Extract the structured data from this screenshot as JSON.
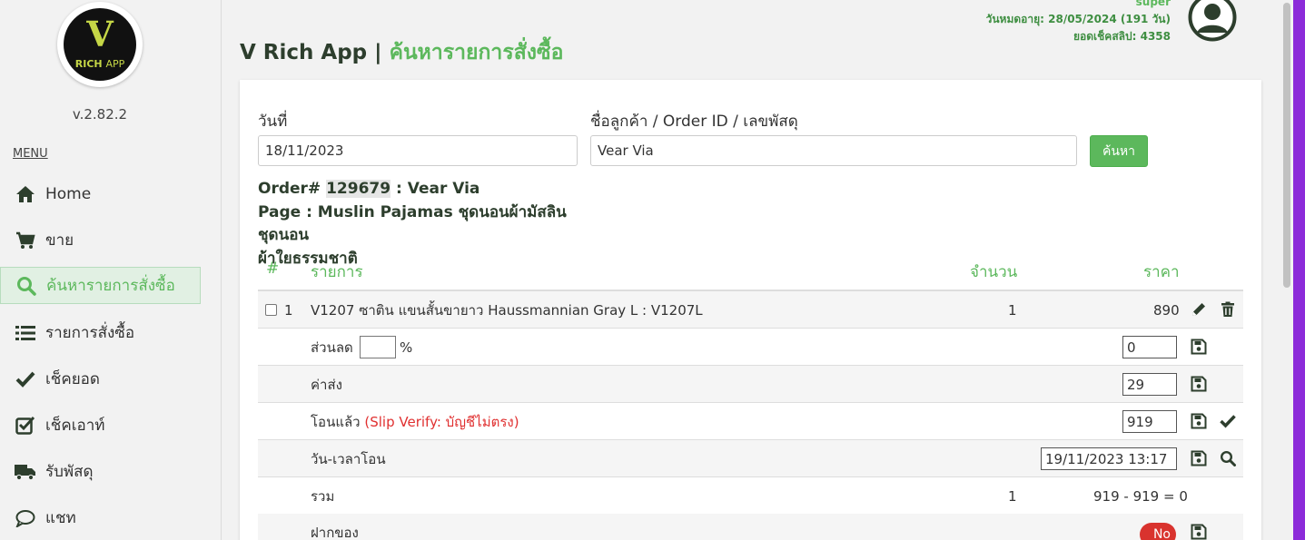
{
  "sidebar": {
    "logo_letter": "V",
    "logo_brand": "RICH",
    "logo_app": "APP",
    "version": "v.2.82.2",
    "menu_title": "MENU",
    "items": [
      {
        "label": "Home",
        "icon": "home-icon"
      },
      {
        "label": "ขาย",
        "icon": "cart-icon"
      },
      {
        "label": "ค้นหารายการสั่งซื้อ",
        "icon": "search-icon",
        "active": true
      },
      {
        "label": "รายการสั่งซื้อ",
        "icon": "list-icon"
      },
      {
        "label": "เช็คยอด",
        "icon": "check-icon"
      },
      {
        "label": "เช็คเอาท์",
        "icon": "check-square-icon"
      },
      {
        "label": "รับพัสดุ",
        "icon": "truck-icon"
      },
      {
        "label": "แชท",
        "icon": "chat-icon"
      }
    ]
  },
  "header": {
    "title_app": "V Rich App |",
    "title_page": "ค้นหารายการสั่งซื้อ",
    "user_name": "super",
    "expiry": "วันหมดอายุ: 28/05/2024 (191 วัน)",
    "slip_balance": "ยอดเช็คสลิป: 4358"
  },
  "search": {
    "date_label": "วันที่",
    "date_value": "18/11/2023",
    "query_label": "ชื่อลูกค้า / Order ID / เลขพัสดุ",
    "query_value": "Vear Via",
    "button_label": "ค้นหา"
  },
  "order": {
    "prefix": "Order#",
    "id": "129679",
    "customer": ": Vear Via",
    "page_line1": "Page : Muslin Pajamas ชุดนอนผ้ามัสลิน ชุดนอน",
    "page_line2": "ผ้าใยธรรมชาติ"
  },
  "table": {
    "headers": {
      "num": "#",
      "item": "รายการ",
      "qty": "จำนวน",
      "price": "ราคา"
    },
    "item_row": {
      "num": "1",
      "name": "V1207 ซาติน แขนสั้นขายาว Haussmannian Gray L : V1207L",
      "qty": "1",
      "price": "890"
    },
    "discount": {
      "label": "ส่วนลด",
      "percent_value": "",
      "percent_sign": "%",
      "value": "0"
    },
    "shipping": {
      "label": "ค่าส่ง",
      "value": "29"
    },
    "transferred": {
      "label": "โอนแล้ว",
      "note": "(Slip Verify: บัญชีไม่ตรง)",
      "value": "919"
    },
    "transfer_time": {
      "label": "วัน-เวลาโอน",
      "value": "19/11/2023 13:17"
    },
    "total": {
      "label": "รวม",
      "qty": "1",
      "calc": "919 - 919 = 0"
    },
    "deposit": {
      "label": "ฝากของ",
      "toggle": "No"
    }
  },
  "colors": {
    "accent": "#5cb85c",
    "dark_title": "#2d3e2d",
    "alert": "#e03030",
    "toggle_off": "#d9332e"
  }
}
